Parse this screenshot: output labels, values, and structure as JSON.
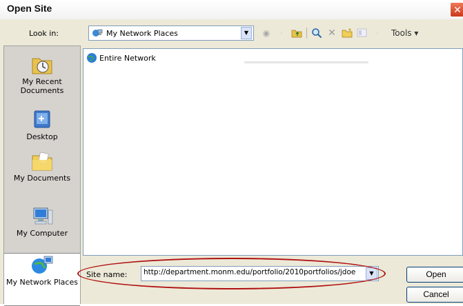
{
  "window": {
    "title": "Open Site"
  },
  "lookin": {
    "label": "Look in:",
    "value": "My Network Places"
  },
  "toolbar": {
    "tools_label": "Tools ▾"
  },
  "places": [
    {
      "label": "My Recent Documents",
      "icon": "recent-documents-icon"
    },
    {
      "label": "Desktop",
      "icon": "desktop-icon"
    },
    {
      "label": "My Documents",
      "icon": "my-documents-icon"
    },
    {
      "label": "My Computer",
      "icon": "my-computer-icon"
    },
    {
      "label": "My Network Places",
      "icon": "network-places-icon",
      "selected": true
    }
  ],
  "files": [
    {
      "name": "Entire Network",
      "icon": "globe-icon"
    }
  ],
  "site_name": {
    "label": "Site name:",
    "value": "http://department.monm.edu/portfolio/2010portfolios/jdoe"
  },
  "buttons": {
    "open": "Open",
    "cancel": "Cancel"
  },
  "colors": {
    "dialog_bg": "#ece9d8",
    "field_border": "#7f9db9",
    "highlight": "#b01010"
  }
}
